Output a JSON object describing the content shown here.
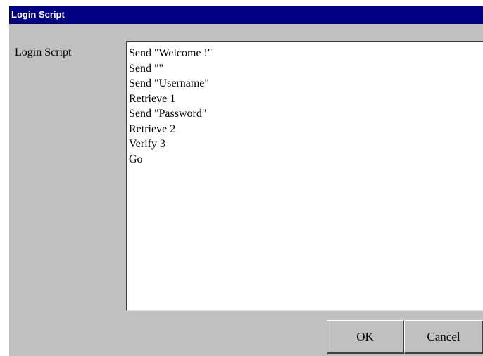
{
  "dialog": {
    "title": "Login Script",
    "field_label": "Login Script",
    "script_lines": [
      "Send \"Welcome !\"",
      "Send \"\"",
      "Send \"Username\"",
      "Retrieve 1",
      "Send \"Password\"",
      "Retrieve 2",
      "Verify 3",
      "Go"
    ],
    "ok_label": "OK",
    "cancel_label": "Cancel"
  },
  "colors": {
    "titlebar": "#000080",
    "dialog_bg": "#c0c0c0",
    "field_bg": "#ffffff"
  }
}
